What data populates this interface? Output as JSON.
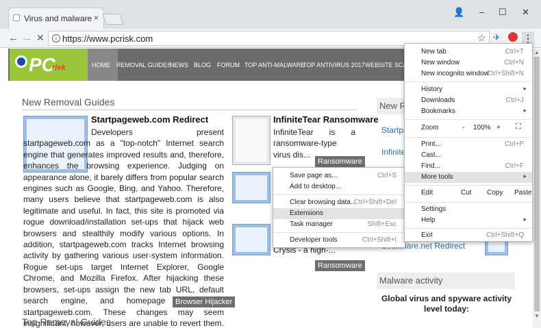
{
  "browser": {
    "tab_title": "Virus and malware remo",
    "url": "https://www.pcrisk.com",
    "close_glyph": "×",
    "minimize_glyph": "–",
    "maximize_glyph": "☐",
    "window_close_glyph": "✕"
  },
  "site": {
    "logo_main": "PC",
    "logo_sub": "risk",
    "nav": [
      "HOME",
      "REMOVAL GUIDES",
      "NEWS",
      "BLOG",
      "FORUM",
      "TOP ANTI-MALWARE",
      "TOP ANTIVIRUS 2017",
      "WEBSITE SCAN"
    ],
    "section_new": "New Removal Guides",
    "section_top": "Top Removal Guides",
    "article1": {
      "title": "Startpageweb.com Redirect",
      "text": "Developers present startpageweb.com as a \"top-notch\" Internet search engine that generates improved results and, therefore, enhances the browsing experience. Judging on appearance alone, it barely differs from popular search engines such as Google, Bing, and Yahoo. Therefore, many users believe that startpageweb.com is also legitimate and useful. In fact, this site is promoted via rogue download/installation set-ups that hijack web browsers and stealthily modify various options. In addition, startpageweb.com tracks Internet browsing activity by gathering various user-system information. Rogue set-ups target Internet Explorer, Google Chrome, and Mozilla Firefox. After hijacking these browsers, set-ups assign the new tab URL, default search engine, and homepage options to startpageweb.com. These changes may seem insignificant, however, users are unable to revert them. Research shows that as well as modifyi...",
      "tag": "Browser Hijacker"
    },
    "article2": {
      "title": "InfiniteTear Ransomware",
      "text": "InfiniteTear is a ransomware-type virus dis...",
      "tag": "Ransomware"
    },
    "article3": {
      "text": "Crysis - a high-...",
      "tag": "Ransomware"
    },
    "sidebar": {
      "heading": "New Re",
      "link1": "Startpa",
      "link2": "InfiniteT",
      "link3": "Sockmare.net Redirect",
      "malware_heading": "Malware activity",
      "global_title": "Global virus and spyware activity level today:"
    }
  },
  "chrome_menu": {
    "items": [
      {
        "label": "New tab",
        "shortcut": "Ctrl+T"
      },
      {
        "label": "New window",
        "shortcut": "Ctrl+N"
      },
      {
        "label": "New incognito window",
        "shortcut": "Ctrl+Shift+N"
      },
      {
        "label": "History",
        "shortcut": "▸"
      },
      {
        "label": "Downloads",
        "shortcut": "Ctrl+J"
      },
      {
        "label": "Bookmarks",
        "shortcut": "▸"
      },
      {
        "label": "Zoom",
        "zoom_minus": "-",
        "zoom_value": "100%",
        "zoom_plus": "+",
        "fullscreen": "⛶"
      },
      {
        "label": "Print...",
        "shortcut": "Ctrl+P"
      },
      {
        "label": "Cast..."
      },
      {
        "label": "Find...",
        "shortcut": "Ctrl+F"
      },
      {
        "label": "More tools",
        "shortcut": "▸"
      },
      {
        "label": "Edit",
        "cut": "Cut",
        "copy": "Copy",
        "paste": "Paste"
      },
      {
        "label": "Settings"
      },
      {
        "label": "Help",
        "shortcut": "▸"
      },
      {
        "label": "Exit",
        "shortcut": "Ctrl+Shift+Q"
      }
    ]
  },
  "more_tools_menu": {
    "items": [
      {
        "label": "Save page as...",
        "shortcut": "Ctrl+S"
      },
      {
        "label": "Add to desktop..."
      },
      {
        "label": "Clear browsing data...",
        "shortcut": "Ctrl+Shift+Del"
      },
      {
        "label": "Extensions"
      },
      {
        "label": "Task manager",
        "shortcut": "Shift+Esc"
      },
      {
        "label": "Developer tools",
        "shortcut": "Ctrl+Shift+I"
      }
    ]
  },
  "colors": {
    "site_nav_bg": "#6b6b6b",
    "logo_green": "#9bc53d",
    "link_blue": "#2a6ebb",
    "menu_highlight": "#e3e3e3"
  }
}
